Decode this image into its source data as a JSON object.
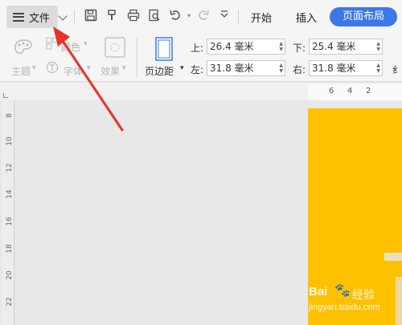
{
  "toolbar": {
    "file_label": "文件",
    "tabs": [
      "开始",
      "插入"
    ],
    "active_tab": "页面布局"
  },
  "ribbon": {
    "theme_label": "主题",
    "color_label": "颜色",
    "font_label": "字体",
    "effect_label": "效果",
    "margin_label": "页边距",
    "top_label": "上:",
    "top_value": "26.4 毫米",
    "bottom_label": "下:",
    "bottom_value": "25.4 毫米",
    "left_label": "左:",
    "left_value": "31.8 毫米",
    "right_label": "右:",
    "right_value": "31.8 毫米",
    "cut_label": "纟"
  },
  "ruler": {
    "h_numbers": [
      "6",
      "4",
      "2"
    ],
    "v_numbers": [
      "8",
      "10",
      "12",
      "14",
      "16",
      "18",
      "20",
      "22"
    ]
  },
  "watermark": {
    "brand": "Bai",
    "brand_suffix": "经验",
    "url": "jingyan.baidu.com"
  },
  "colors": {
    "accent": "#3c78e8",
    "page": "#ffc000",
    "arrow": "#e8322a"
  }
}
